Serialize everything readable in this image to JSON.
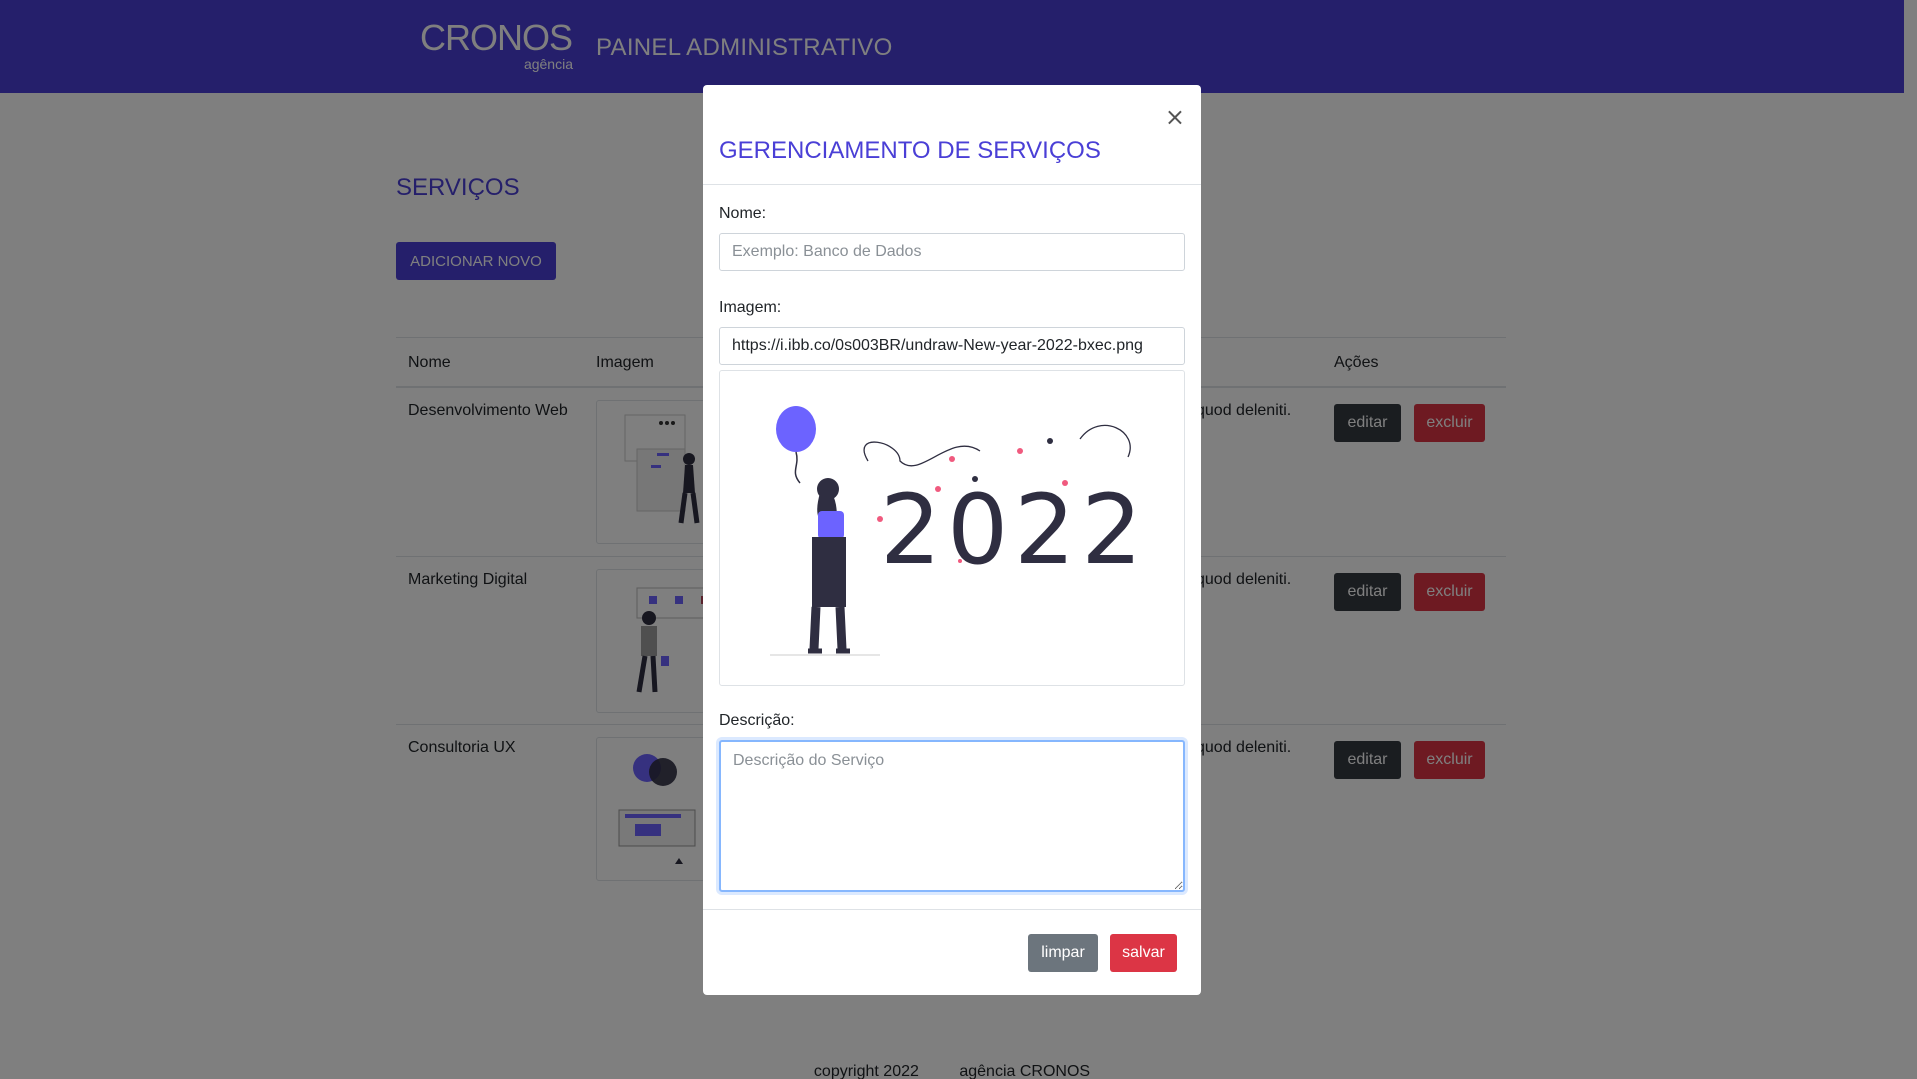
{
  "header": {
    "brand": "CRONOS",
    "brand_sub": "agência",
    "panel_title": "PAINEL ADMINISTRATIVO"
  },
  "page": {
    "title": "SERVIÇOS",
    "add_button": "ADICIONAR NOVO"
  },
  "table": {
    "columns": [
      "Nome",
      "Imagem",
      "Ações"
    ],
    "rows": [
      {
        "name": "Desenvolvimento Web",
        "desc_fragment": "quod deleniti.",
        "edit": "editar",
        "delete": "excluir"
      },
      {
        "name": "Marketing Digital",
        "desc_fragment": "quod deleniti.",
        "edit": "editar",
        "delete": "excluir"
      },
      {
        "name": "Consultoria UX",
        "desc_fragment": "quod deleniti.",
        "edit": "editar",
        "delete": "excluir"
      }
    ]
  },
  "footer": {
    "copyright": "copyright 2022",
    "agency": "agência CRONOS"
  },
  "modal": {
    "close": "×",
    "title": "GERENCIAMENTO DE SERVIÇOS",
    "name_label": "Nome:",
    "name_placeholder": "Exemplo: Banco de Dados",
    "image_label": "Imagem:",
    "image_value": "https://i.ibb.co/0s003BR/undraw-New-year-2022-bxec.png",
    "preview_text": "2022",
    "desc_label": "Descrição:",
    "desc_placeholder": "Descrição do Serviço",
    "clear_button": "limpar",
    "save_button": "salvar"
  },
  "colors": {
    "brand": "#4a3fd6",
    "danger": "#dc3545",
    "dark": "#343a40",
    "secondary": "#6c757d"
  }
}
